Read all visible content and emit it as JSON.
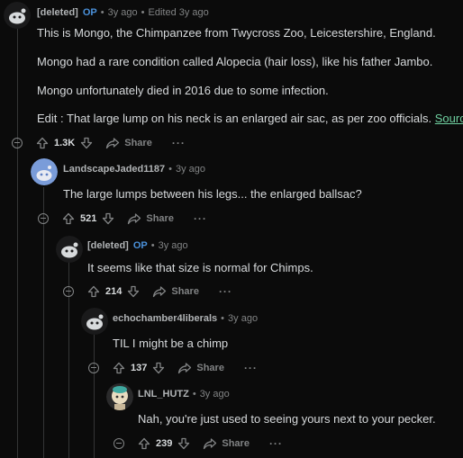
{
  "comments": [
    {
      "user": "[deleted]",
      "op": "OP",
      "time": "3y ago",
      "edited": "Edited 3y ago",
      "paragraphs": [
        "This is Mongo, the Chimpanzee from Twycross Zoo, Leicestershire, England.",
        "Mongo had a rare condition called Alopecia (hair loss), like his father Jambo.",
        "Mongo unfortunately died in 2016 due to some infection."
      ],
      "edit_text": "Edit : That large lump on his neck is an enlarged air sac, as per zoo officials.",
      "edit_link": "Source",
      "edit_period": ".",
      "score": "1.3K",
      "share": "Share",
      "more": "···"
    },
    {
      "user": "LandscapeJaded1187",
      "time": "3y ago",
      "text": "The large lumps between his legs... the enlarged ballsac?",
      "score": "521",
      "share": "Share",
      "more": "···"
    },
    {
      "user": "[deleted]",
      "op": "OP",
      "time": "3y ago",
      "text": "It seems like that size is normal for Chimps.",
      "score": "214",
      "share": "Share",
      "more": "···"
    },
    {
      "user": "echochamber4liberals",
      "time": "3y ago",
      "text": "TIL I might be a chimp",
      "score": "137",
      "share": "Share",
      "more": "···"
    },
    {
      "user": "LNL_HUTZ",
      "time": "3y ago",
      "text": "Nah, you're just used to seeing yours next to your pecker.",
      "score": "239",
      "share": "Share",
      "more": "···"
    }
  ],
  "meta_separator": "•",
  "colors": {
    "background": "#0b0b0b",
    "op_badge": "#4a90d9",
    "link": "#6fd0a0",
    "thread_line": "#343536"
  }
}
